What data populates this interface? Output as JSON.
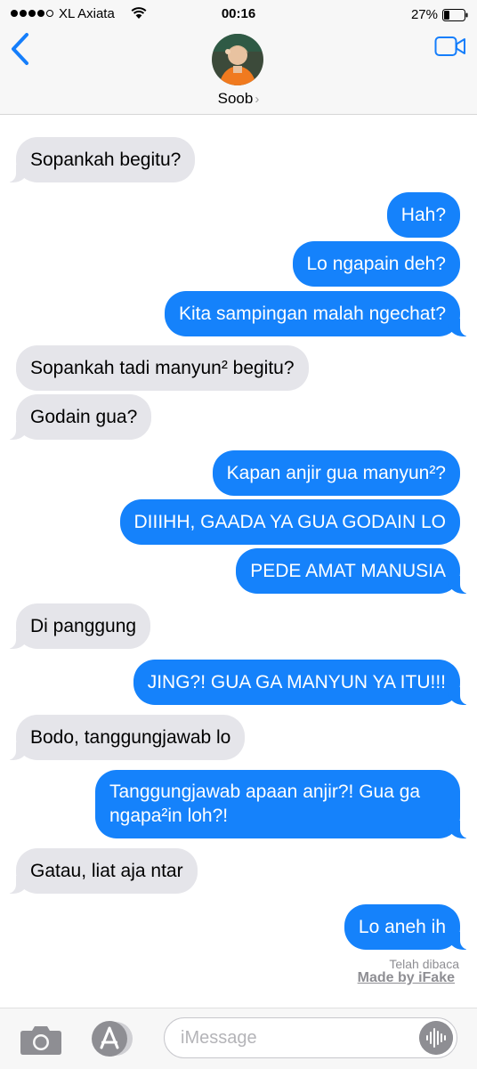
{
  "status_bar": {
    "carrier": "XL Axiata",
    "time": "00:16",
    "battery": "27%",
    "battery_level": 0.27
  },
  "header": {
    "contact_name": "Soob",
    "chevron": "›",
    "icons": [
      "back-chevron-icon",
      "video-camera-icon"
    ]
  },
  "messages": [
    {
      "dir": "in",
      "text": "Sopankah begitu?"
    },
    {
      "dir": "out",
      "text": "Hah?"
    },
    {
      "dir": "out",
      "text": "Lo ngapain deh?"
    },
    {
      "dir": "out",
      "text": "Kita sampingan malah ngechat?"
    },
    {
      "dir": "in",
      "text": "Sopankah tadi manyun² begitu?"
    },
    {
      "dir": "in",
      "text": "Godain gua?"
    },
    {
      "dir": "out",
      "text": "Kapan anjir gua manyun²?"
    },
    {
      "dir": "out",
      "text": "DIIIHH, GAADA YA GUA GODAIN LO"
    },
    {
      "dir": "out",
      "text": "PEDE AMAT MANUSIA"
    },
    {
      "dir": "in",
      "text": "Di panggung"
    },
    {
      "dir": "out",
      "text": "JING?! GUA GA MANYUN YA ITU!!!"
    },
    {
      "dir": "in",
      "text": "Bodo, tanggungjawab lo"
    },
    {
      "dir": "out",
      "text": "Tanggungjawab apaan anjir?! Gua ga ngapa²in loh?!"
    },
    {
      "dir": "in",
      "text": "Gatau, liat aja ntar"
    },
    {
      "dir": "out",
      "text": "Lo aneh ih"
    }
  ],
  "read_receipt": "Telah dibaca",
  "watermark": "Made by iFake",
  "composer": {
    "placeholder": "iMessage",
    "icons": [
      "camera-icon",
      "app-store-icon",
      "audio-waveform-icon"
    ]
  },
  "colors": {
    "outgoing_bubble": "#1582fb",
    "incoming_bubble": "#e5e5ea",
    "accent": "#157efb"
  }
}
